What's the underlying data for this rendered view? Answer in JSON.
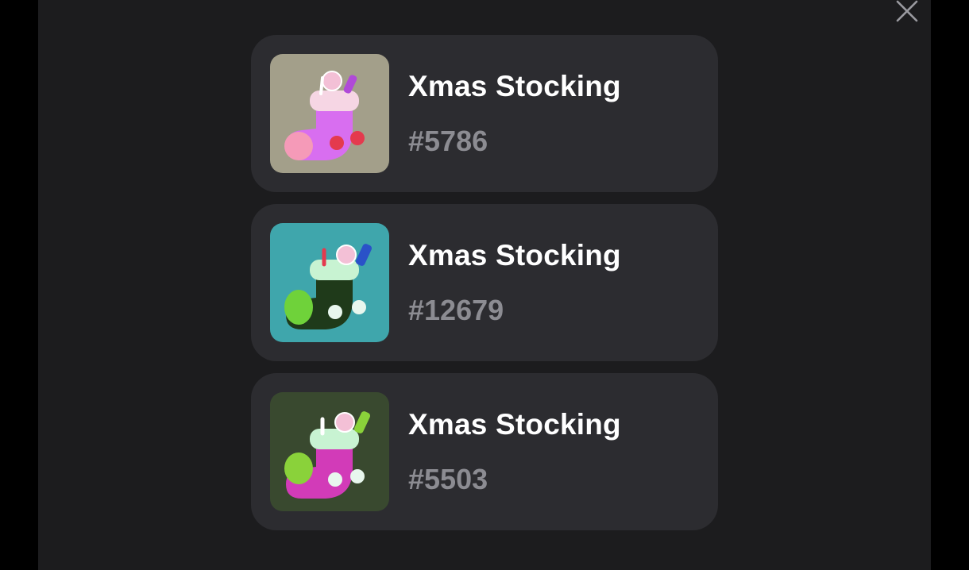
{
  "close_icon": "close-icon",
  "items": [
    {
      "title": "Xmas Stocking",
      "number": "#5786",
      "background": "#a39f8a",
      "stocking_color": "#d86ef0",
      "cuff_color": "#f6d6e4",
      "toe_color": "#f59ab8",
      "accent_color": "#e43a4e"
    },
    {
      "title": "Xmas Stocking",
      "number": "#12679",
      "background": "#3fa6ac",
      "stocking_color": "#1f3a1a",
      "cuff_color": "#c8f3d2",
      "toe_color": "#6fd23a",
      "accent_color": "#e8f7ee"
    },
    {
      "title": "Xmas Stocking",
      "number": "#5503",
      "background": "#39492f",
      "stocking_color": "#d23bb8",
      "cuff_color": "#c8f3d2",
      "toe_color": "#8ad23a",
      "accent_color": "#e8f7ee"
    }
  ]
}
